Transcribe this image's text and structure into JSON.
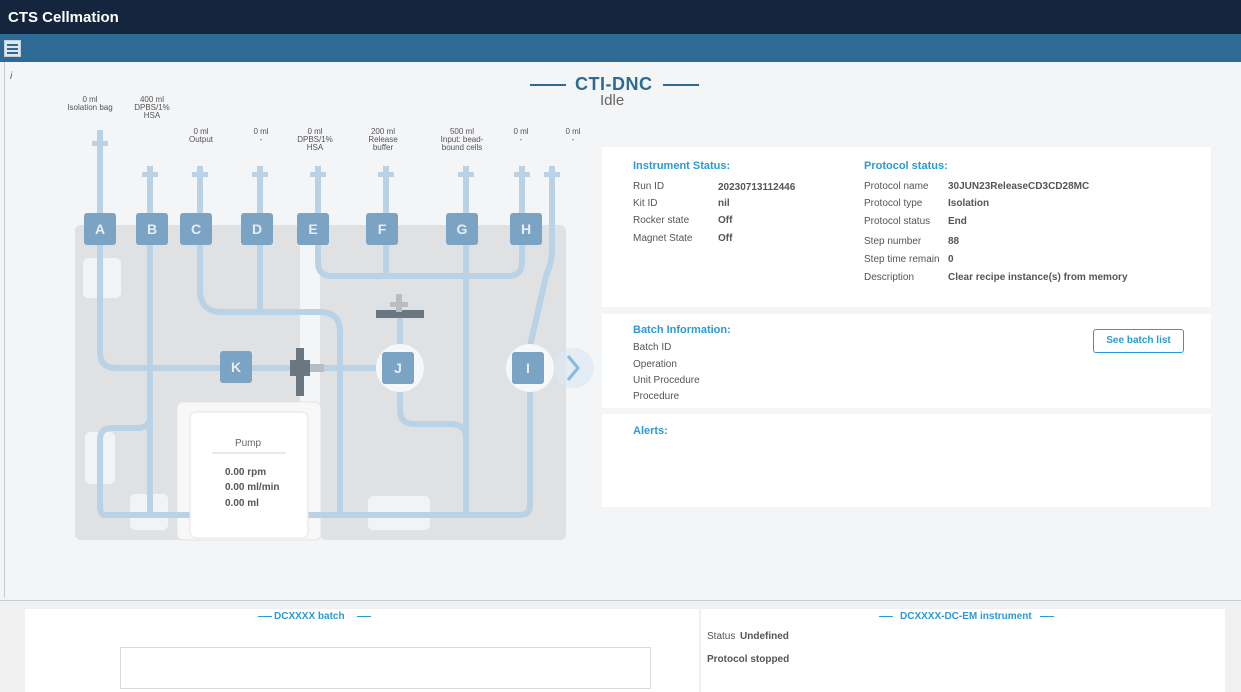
{
  "app": {
    "title": "CTS Cellmation"
  },
  "device": {
    "name": "CTI-DNC",
    "state": "Idle"
  },
  "info_marker": "i",
  "valve_labels": [
    {
      "amount": "0 ml",
      "name": "Isolation bag"
    },
    {
      "amount": "400 ml",
      "name": "DPBS/1%\nHSA"
    },
    {
      "amount": "0 ml",
      "name": "Output"
    },
    {
      "amount": "0 ml",
      "name": "-"
    },
    {
      "amount": "0 ml",
      "name": "DPBS/1%\nHSA"
    },
    {
      "amount": "200 ml",
      "name": "Release\nbuffer"
    },
    {
      "amount": "500 ml",
      "name": "Input: bead-\nbound cells"
    },
    {
      "amount": "0 ml",
      "name": "-"
    },
    {
      "amount": "0 ml",
      "name": "-"
    }
  ],
  "valves": [
    "A",
    "B",
    "C",
    "D",
    "E",
    "F",
    "G",
    "H",
    "K",
    "J",
    "I"
  ],
  "pump": {
    "title": "Pump",
    "rpm": "0.00 rpm",
    "flow": "0.00 ml/min",
    "volume": "0.00 ml"
  },
  "instrument_status": {
    "title": "Instrument Status:",
    "rows": [
      {
        "label": "Run ID",
        "value": "20230713112446"
      },
      {
        "label": "Kit ID",
        "value": "nil"
      },
      {
        "label": "Rocker state",
        "value": "Off"
      },
      {
        "label": "Magnet State",
        "value": "Off"
      }
    ]
  },
  "protocol_status": {
    "title": "Protocol status:",
    "rows": [
      {
        "label": "Protocol name",
        "value": "30JUN23ReleaseCD3CD28MC"
      },
      {
        "label": "Protocol type",
        "value": "Isolation"
      },
      {
        "label": "Protocol status",
        "value": "End"
      },
      {
        "label": "Step number",
        "value": "88"
      },
      {
        "label": "Step time remain",
        "value": "0"
      },
      {
        "label": "Description",
        "value": "Clear recipe instance(s) from memory"
      }
    ]
  },
  "batch": {
    "title": "Batch Information:",
    "rows": [
      "Batch ID",
      "Operation",
      "Unit Procedure",
      "Procedure"
    ],
    "button": "See batch list"
  },
  "alerts": {
    "title": "Alerts:"
  },
  "footer": {
    "batch_title": "DCXXXX batch",
    "instrument_title": "DCXXXX-DC-EM instrument",
    "status_label": "Status",
    "status_value": "Undefined",
    "protocol_text": "Protocol stopped"
  },
  "colors": {
    "titlebar": "#14253d",
    "toolbar": "#2d6b96",
    "accent": "#2b9ad6",
    "tube": "#b9d2e6",
    "valve": "#7aa3c4"
  }
}
